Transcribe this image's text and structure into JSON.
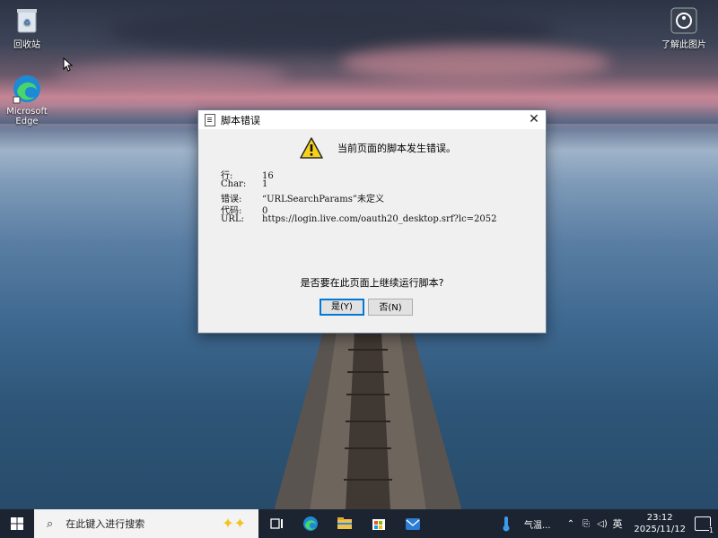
{
  "desktop": {
    "icons": [
      {
        "label": "回收站"
      },
      {
        "label": "Microsoft Edge"
      },
      {
        "label": "了解此图片"
      }
    ]
  },
  "dialog": {
    "title": "脚本错误",
    "close_glyph": "✕",
    "headline": "当前页面的脚本发生错误。",
    "fields": [
      {
        "key": "行:",
        "value": "16"
      },
      {
        "key": "Char:",
        "value": "1"
      },
      {
        "key": "错误:",
        "value": "“URLSearchParams”未定义"
      },
      {
        "key": "代码:",
        "value": "0"
      },
      {
        "key": "URL:",
        "value": "https://login.live.com/oauth20_desktop.srf?lc=2052"
      }
    ],
    "question": "是否要在此页面上继续运行脚本?",
    "yes_label": "是(Y)",
    "no_label": "否(N)"
  },
  "taskbar": {
    "search_placeholder": "在此键入进行搜索",
    "weather_text": "气温...",
    "ime": "英",
    "time": "23:12",
    "date": "2025/11/12",
    "notification_count": "1"
  }
}
